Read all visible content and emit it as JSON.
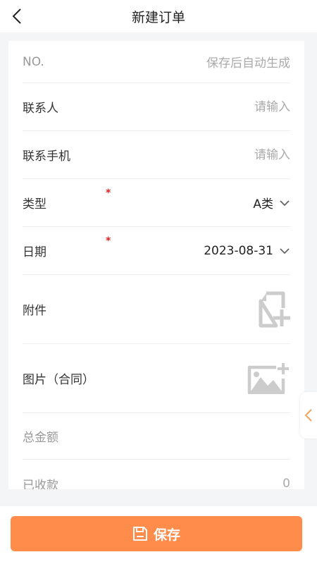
{
  "header": {
    "title": "新建订单",
    "back_icon": "chevron-left-icon"
  },
  "form": {
    "order_no": {
      "label": "NO.",
      "value": "保存后自动生成"
    },
    "contact": {
      "label": "联系人",
      "placeholder": "请输入"
    },
    "phone": {
      "label": "联系手机",
      "placeholder": "请输入"
    },
    "type": {
      "label": "类型",
      "required_mark": "*",
      "value": "A类"
    },
    "date": {
      "label": "日期",
      "required_mark": "*",
      "value": "2023-08-31"
    },
    "attachment": {
      "label": "附件",
      "icon": "add-file-icon"
    },
    "image": {
      "label": "图片（合同）",
      "icon": "add-image-icon"
    },
    "total": {
      "label": "总金额"
    },
    "received": {
      "label": "已收款",
      "value": "0"
    }
  },
  "side_tab": {
    "icon": "chevron-left-icon"
  },
  "footer": {
    "save_label": "保存",
    "save_icon": "save-icon"
  },
  "colors": {
    "accent": "#ff8c4b",
    "required": "#e02020",
    "side_tab_icon": "#f0a35e",
    "icon_gray": "#cccccc"
  }
}
